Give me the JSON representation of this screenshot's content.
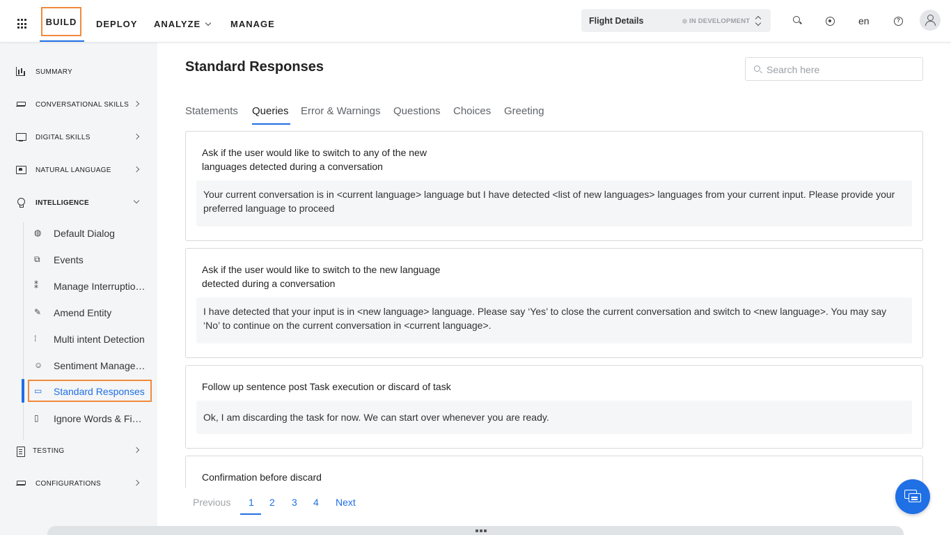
{
  "topbar": {
    "nav": [
      {
        "label": "BUILD"
      },
      {
        "label": "DEPLOY"
      },
      {
        "label": "ANALYZE"
      },
      {
        "label": "MANAGE"
      }
    ],
    "bot_name": "Flight Details",
    "bot_status": "IN DEVELOPMENT",
    "language": "en"
  },
  "sidebar": {
    "items": [
      {
        "label": "SUMMARY",
        "icon": "bar-chart-icon"
      },
      {
        "label": "CONVERSATIONAL SKILLS",
        "icon": "stack-icon"
      },
      {
        "label": "DIGITAL SKILLS",
        "icon": "monitor-icon"
      },
      {
        "label": "NATURAL LANGUAGE",
        "icon": "natural-language-icon"
      },
      {
        "label": "INTELLIGENCE",
        "icon": "bulb-icon"
      },
      {
        "label": "TESTING",
        "icon": "clipboard-icon"
      },
      {
        "label": "CONFIGURATIONS",
        "icon": "stack-icon"
      }
    ],
    "intelligence_sub": [
      {
        "label": "Default Dialog",
        "icon": "globe-icon"
      },
      {
        "label": "Events",
        "icon": "events-icon"
      },
      {
        "label": "Manage Interruptions",
        "icon": "interruption-icon"
      },
      {
        "label": "Amend Entity",
        "icon": "edit-icon"
      },
      {
        "label": "Multi intent Detection",
        "icon": "multi-intent-icon"
      },
      {
        "label": "Sentiment Management",
        "icon": "smiley-icon"
      },
      {
        "label": "Standard Responses",
        "icon": "chat-icon"
      },
      {
        "label": "Ignore Words & Field Memory",
        "icon": "document-icon"
      }
    ]
  },
  "main": {
    "title": "Standard Responses",
    "search_placeholder": "Search here",
    "tabs": [
      "Statements",
      "Queries",
      "Error & Warnings",
      "Questions",
      "Choices",
      "Greeting"
    ],
    "active_tab": "Queries",
    "cards": [
      {
        "title_line1": "Ask if the user would like to switch to any of the new",
        "title_line2": "languages detected during a conversation",
        "response": "Your current conversation is in <current language> language but I have detected <list of new languages> languages from your current input. Please provide your preferred language to proceed"
      },
      {
        "title_line1": "Ask if the user would like to switch to the new language",
        "title_line2": "detected during a conversation",
        "response": "I have detected that your input is in <new language> language. Please say ‘Yes’ to close the current conversation and switch to <new language>. You may say ‘No’ to continue on the current conversation in <current language>."
      },
      {
        "title_line1": "Follow up sentence post Task execution or discard of task",
        "response": "Ok, I am discarding the task for now. We can start over whenever you are ready."
      },
      {
        "title_line1": "Confirmation before discard"
      }
    ],
    "pagination": {
      "previous": "Previous",
      "pages": [
        "1",
        "2",
        "3",
        "4"
      ],
      "current": "1",
      "next": "Next"
    }
  }
}
